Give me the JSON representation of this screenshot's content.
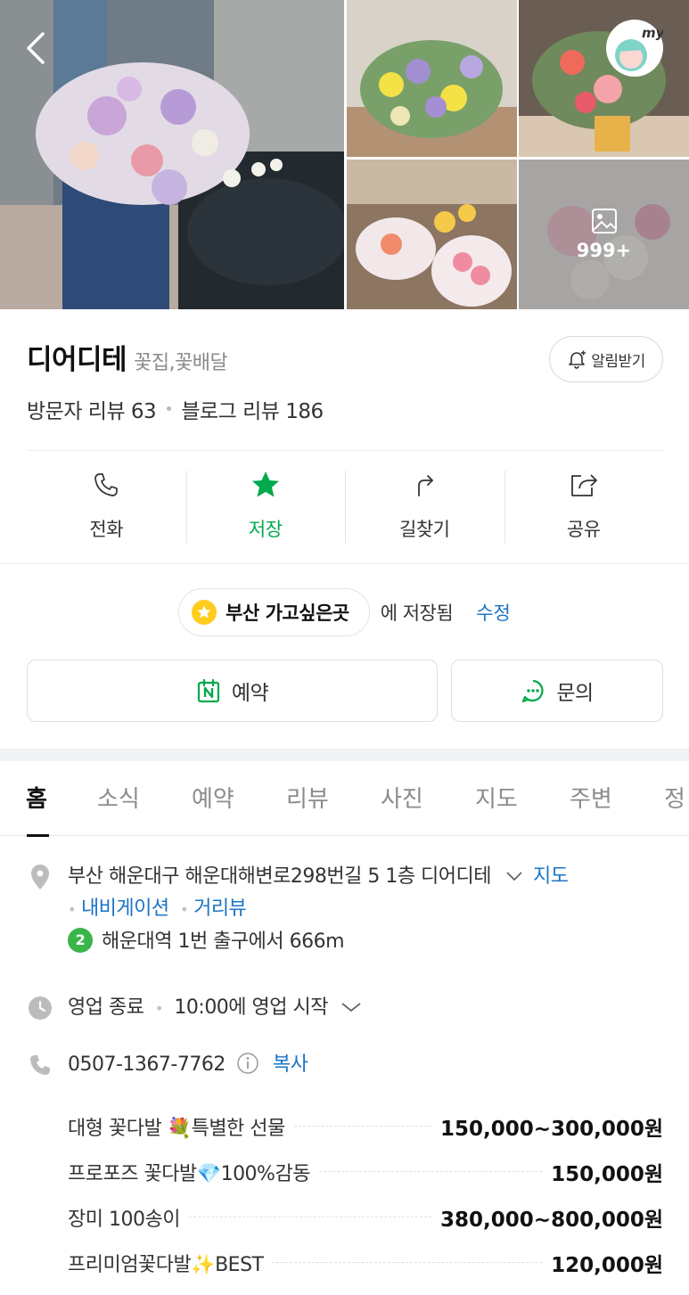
{
  "gallery": {
    "photo_count": "999+"
  },
  "place": {
    "name": "디어디테",
    "category": "꽃집,꽃배달",
    "notify_label": "알림받기",
    "visitor_reviews": "방문자 리뷰 63",
    "blog_reviews": "블로그 리뷰 186"
  },
  "actions": [
    {
      "label": "전화",
      "icon": "phone-icon"
    },
    {
      "label": "저장",
      "icon": "star-icon",
      "active": true
    },
    {
      "label": "길찾기",
      "icon": "directions-icon"
    },
    {
      "label": "공유",
      "icon": "share-icon"
    }
  ],
  "saved": {
    "list_name": "부산 가고싶은곳",
    "suffix": "에 저장됨",
    "edit_label": "수정"
  },
  "buttons": {
    "reserve": "예약",
    "inquire": "문의"
  },
  "tabs": [
    "홈",
    "소식",
    "예약",
    "리뷰",
    "사진",
    "지도",
    "주변",
    "정"
  ],
  "info": {
    "address": "부산 해운대구 해운대해변로298번길 5 1층 디어디테",
    "map_link": "지도",
    "navigation_link": "내비게이션",
    "street_view_link": "거리뷰",
    "subway_line": "2",
    "subway_text": "해운대역 1번 출구에서 666m",
    "hours_status": "영업 종료",
    "hours_detail": "10:00에 영업 시작",
    "phone": "0507-1367-7762",
    "copy_label": "복사"
  },
  "prices": [
    {
      "name": "대형 꽃다발 💐특별한 선물",
      "price": "150,000~300,000원"
    },
    {
      "name": "프로포즈 꽃다발💎100%감동",
      "price": "150,000원"
    },
    {
      "name": "장미 100송이",
      "price": "380,000~800,000원"
    },
    {
      "name": "프리미엄꽃다발✨BEST",
      "price": "120,000원"
    }
  ],
  "colors": {
    "accent_green": "#03a94d",
    "link_blue": "#1c74c6",
    "star_yellow": "#ffcc1e"
  }
}
